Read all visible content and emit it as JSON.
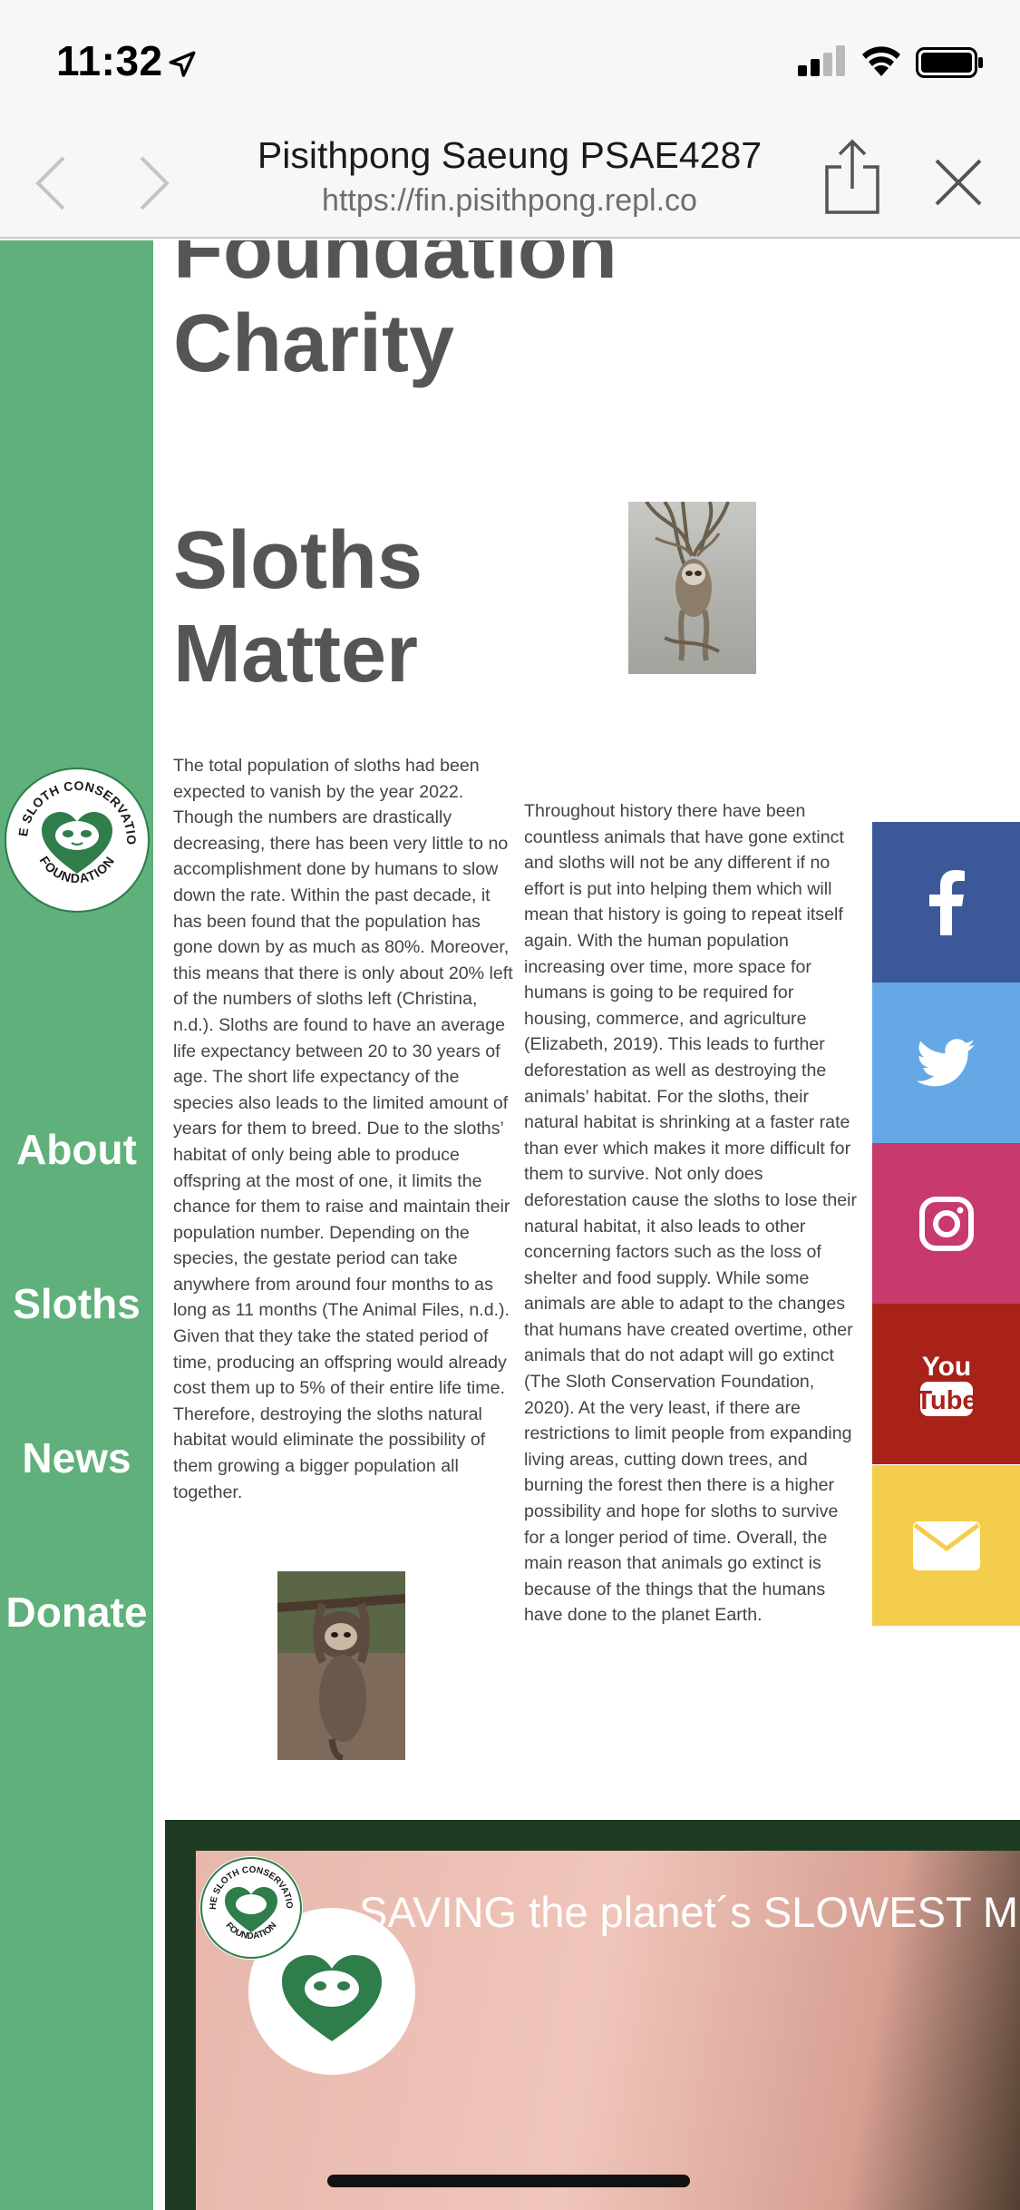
{
  "status_bar": {
    "time": "11:32"
  },
  "browser": {
    "title": "Pisithpong Saeung PSAE4287",
    "url": "https://fin.pisithpong.repl.co"
  },
  "sidebar": {
    "links": [
      "About",
      "Sloths",
      "News",
      "Donate"
    ]
  },
  "headings": {
    "foundation": "Foundation",
    "charity": "Charity",
    "sloths": "Sloths",
    "matter": "Matter"
  },
  "article": {
    "left": "The total population of sloths had been expected to vanish by the year 2022. Though the numbers are drastically decreasing, there has been very little to no accomplishment done by humans to slow down the rate. Within the past decade, it has been found that the population has gone down by as much as 80%. Moreover, this means that there is only about 20% left of the numbers of sloths left (Christina, n.d.). Sloths are found to have an average life expectancy between 20 to 30 years of age. The short life expectancy of the species also leads to the limited amount of years for them to breed. Due to the sloths’ habitat of only being able to produce offspring at the most of one, it limits the chance for them to raise and maintain their population number. Depending on the species, the gestate period can take anywhere from around four months to as long as 11 months (The Animal Files, n.d.). Given that they take the stated period of time, producing an offspring would already cost them up to 5% of their entire life time. Therefore, destroying the sloths natural habitat would eliminate the possibility of them growing a bigger population all together.",
    "right": "Throughout history there have been countless animals that have gone extinct and sloths will not be any different if no effort is put into helping them which will mean that history is going to repeat itself again. With the human population increasing over time, more space for humans is going to be required for housing, commerce, and agriculture (Elizabeth, 2019). This leads to further deforestation as well as destroying the animals’ habitat. For the sloths, their natural habitat is shrinking at a faster rate than ever which makes it more difficult for them to survive. Not only does deforestation cause the sloths to lose their natural habitat, it also leads to other concerning factors such as the loss of shelter and food supply. While some animals are able to adapt to the changes that humans have created overtime, other animals that do not adapt will go extinct (The Sloth Conservation Foundation, 2020). At the very least, if there are restrictions to limit people from expanding living areas, cutting down trees, and burning the forest then there is a higher possibility and hope for sloths to survive for a longer period of time. Overall, the main reason that animals go extinct is because of the things that the humans have done to the planet Earth."
  },
  "social": [
    {
      "icon": "facebook-icon",
      "color": "#3b5998"
    },
    {
      "icon": "twitter-icon",
      "color": "#64a8e6"
    },
    {
      "icon": "instagram-icon",
      "color": "#c8396e"
    },
    {
      "icon": "youtube-icon",
      "color": "#a82218"
    },
    {
      "icon": "mail-icon",
      "color": "#f5cd4c"
    }
  ],
  "logo": {
    "text_top": "THE SLOTH CONSERVATION",
    "text_bottom": "FOUNDATION"
  },
  "video": {
    "title": "SAVING the planet´s SLOWEST M"
  },
  "colors": {
    "sidebar": "#5fb07a",
    "heading": "#555555",
    "logo_green": "#2e7d4a"
  }
}
